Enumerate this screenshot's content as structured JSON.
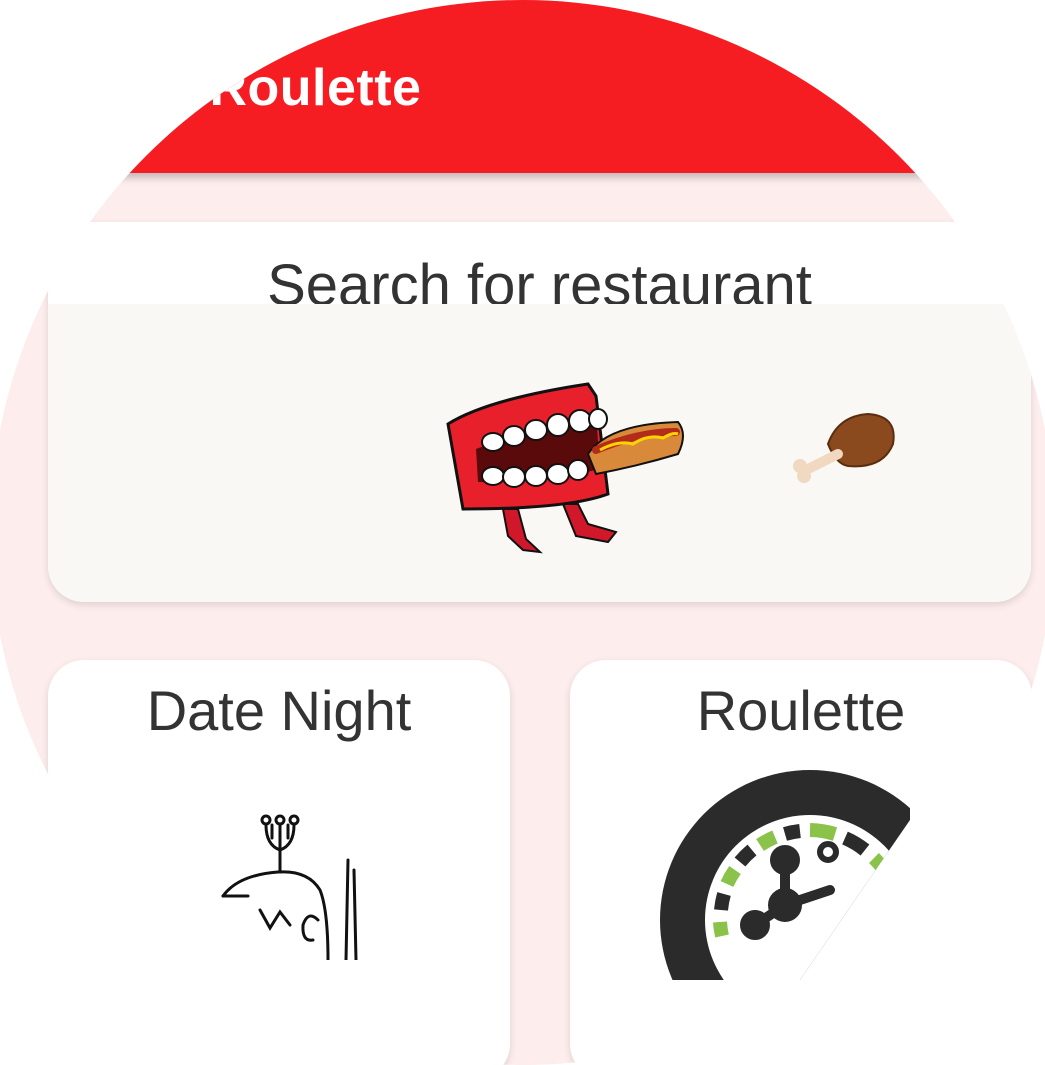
{
  "app_bar": {
    "title": "urant Roulette"
  },
  "search_card": {
    "title": "Search for restaurant"
  },
  "tiles": [
    {
      "title": "Date Night"
    },
    {
      "title": "Roulette"
    }
  ],
  "colors": {
    "app_bar": "#f51c22",
    "background": "#fdeded",
    "card": "#ffffff",
    "text": "#333333",
    "roulette_accent": "#8bc34a",
    "roulette_dark": "#2b2b2b"
  },
  "icons": {
    "search_art": [
      "chattering-teeth-hotdog-icon",
      "chicken-drumstick-icon"
    ],
    "date_night": "candlelight-dinner-icon",
    "roulette": "roulette-wheel-icon"
  }
}
